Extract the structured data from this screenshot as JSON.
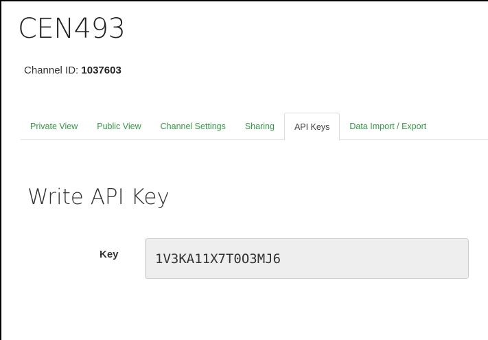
{
  "channel": {
    "title": "CEN493",
    "id_label": "Channel ID: ",
    "id_value": "1037603"
  },
  "tabs": [
    {
      "label": "Private View",
      "active": false
    },
    {
      "label": "Public View",
      "active": false
    },
    {
      "label": "Channel Settings",
      "active": false
    },
    {
      "label": "Sharing",
      "active": false
    },
    {
      "label": "API Keys",
      "active": true
    },
    {
      "label": "Data Import / Export",
      "active": false
    }
  ],
  "write_api_key": {
    "title": "Write API Key",
    "key_label": "Key",
    "key_value": "1V3KA11X7T0O3MJ6"
  },
  "colors": {
    "tab_link": "#2e9e3e",
    "active_tab_text": "#444444",
    "key_field_background": "#eeeeee"
  }
}
